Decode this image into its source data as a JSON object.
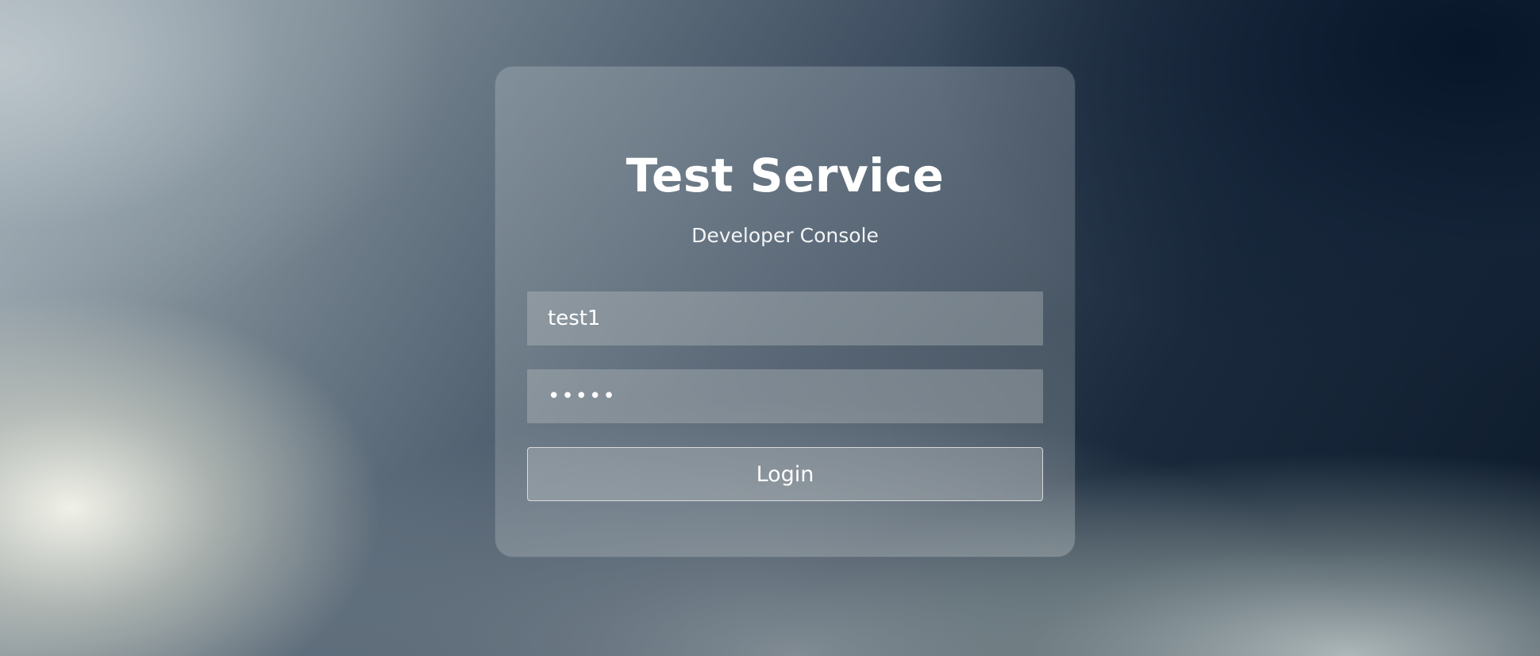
{
  "login": {
    "title": "Test Service",
    "subtitle": "Developer Console",
    "username": {
      "value": "test1",
      "placeholder": ""
    },
    "password": {
      "value": "•••••",
      "placeholder": ""
    },
    "button_label": "Login"
  }
}
